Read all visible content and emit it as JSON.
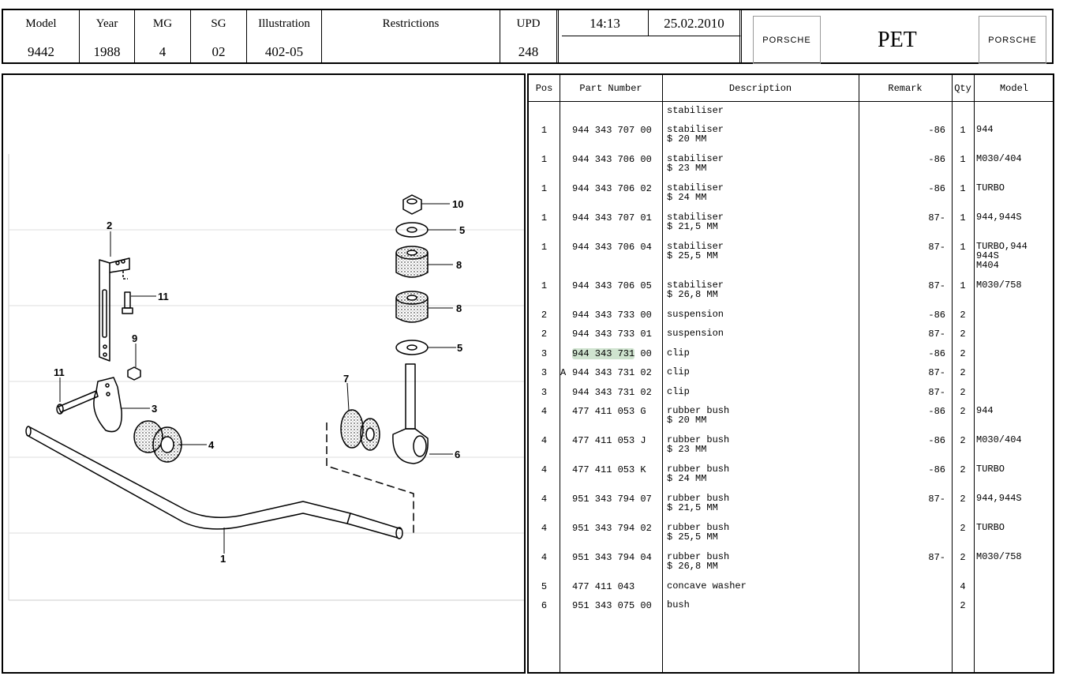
{
  "header": {
    "model_label": "Model",
    "model": "9442",
    "year_label": "Year",
    "year": "1988",
    "mg_label": "MG",
    "mg": "4",
    "sg_label": "SG",
    "sg": "02",
    "illus_label": "Illustration",
    "illus": "402-05",
    "restr_label": "Restrictions",
    "restr": "",
    "upd_label": "UPD",
    "upd": "248",
    "time": "14:13",
    "date": "25.02.2010",
    "logo_left": "PORSCHE",
    "title": "PET",
    "logo_right": "PORSCHE"
  },
  "table": {
    "headers": {
      "pos": "Pos",
      "part": "Part Number",
      "desc": "Description",
      "remark": "Remark",
      "qty": "Qty",
      "model": "Model"
    },
    "rows": [
      {
        "pos": "",
        "part": "",
        "desc": "stabiliser",
        "remark": "",
        "qty": "",
        "model": ""
      },
      {
        "pos": "1",
        "part": "944 343 707 00",
        "desc": "stabiliser\n$ 20 MM",
        "remark": "-86",
        "qty": "1",
        "model": "944"
      },
      {
        "pos": "1",
        "part": "944 343 706 00",
        "desc": "stabiliser\n$ 23 MM",
        "remark": "-86",
        "qty": "1",
        "model": "M030/404"
      },
      {
        "pos": "1",
        "part": "944 343 706 02",
        "desc": "stabiliser\n$ 24 MM",
        "remark": "-86",
        "qty": "1",
        "model": "TURBO"
      },
      {
        "pos": "1",
        "part": "944 343 707 01",
        "desc": "stabiliser\n$ 21,5 MM",
        "remark": "87-",
        "qty": "1",
        "model": "944,944S"
      },
      {
        "pos": "1",
        "part": "944 343 706 04",
        "desc": "stabiliser\n$ 25,5 MM",
        "remark": "87-",
        "qty": "1",
        "model": "TURBO,944\n944S\nM404"
      },
      {
        "pos": "1",
        "part": "944 343 706 05",
        "desc": "stabiliser\n$ 26,8 MM",
        "remark": "87-",
        "qty": "1",
        "model": "M030/758"
      },
      {
        "pos": "2",
        "part": "944 343 733 00",
        "desc": "suspension",
        "remark": "-86",
        "qty": "2",
        "model": ""
      },
      {
        "pos": "2",
        "part": "944 343 733 01",
        "desc": "suspension",
        "remark": "87-",
        "qty": "2",
        "model": ""
      },
      {
        "pos": "3",
        "part": "944 343 731 00",
        "desc": "clip",
        "remark": "-86",
        "qty": "2",
        "model": "",
        "selected": "944 343 731"
      },
      {
        "pos": "3",
        "flag": "A",
        "part": "944 343 731 02",
        "desc": "clip",
        "remark": "87-",
        "qty": "2",
        "model": ""
      },
      {
        "pos": "3",
        "part": "944 343 731 02",
        "desc": "clip",
        "remark": "87-",
        "qty": "2",
        "model": ""
      },
      {
        "pos": "4",
        "part": "477 411 053 G",
        "desc": "rubber bush\n$ 20 MM",
        "remark": "-86",
        "qty": "2",
        "model": "944"
      },
      {
        "pos": "4",
        "part": "477 411 053 J",
        "desc": "rubber bush\n$ 23 MM",
        "remark": "-86",
        "qty": "2",
        "model": "M030/404"
      },
      {
        "pos": "4",
        "part": "477 411 053 K",
        "desc": "rubber bush\n$ 24 MM",
        "remark": "-86",
        "qty": "2",
        "model": "TURBO"
      },
      {
        "pos": "4",
        "part": "951 343 794 07",
        "desc": "rubber bush\n$ 21,5 MM",
        "remark": "87-",
        "qty": "2",
        "model": "944,944S"
      },
      {
        "pos": "4",
        "part": "951 343 794 02",
        "desc": "rubber bush\n$ 25,5 MM",
        "remark": "",
        "qty": "2",
        "model": "TURBO"
      },
      {
        "pos": "4",
        "part": "951 343 794 04",
        "desc": "rubber bush\n$ 26,8 MM",
        "remark": "87-",
        "qty": "2",
        "model": "M030/758"
      },
      {
        "pos": "5",
        "part": "477 411 043",
        "desc": "concave washer",
        "remark": "",
        "qty": "4",
        "model": ""
      },
      {
        "pos": "6",
        "part": "951 343 075 00",
        "desc": "bush",
        "remark": "",
        "qty": "2",
        "model": ""
      }
    ]
  },
  "callouts": [
    "1",
    "2",
    "3",
    "4",
    "5",
    "5",
    "6",
    "7",
    "8",
    "8",
    "9",
    "10",
    "11",
    "11"
  ]
}
